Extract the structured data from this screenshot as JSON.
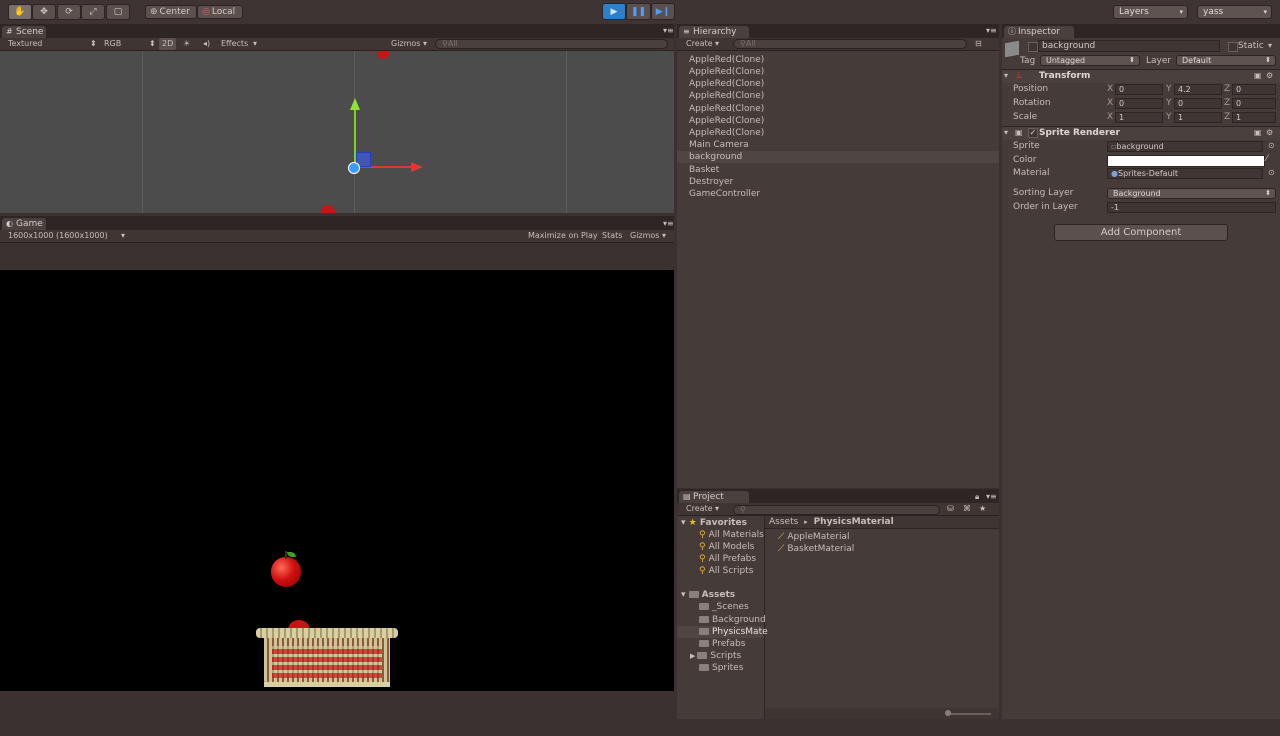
{
  "toolbar": {
    "pivot_label": "Center",
    "space_label": "Local",
    "layers_label": "Layers",
    "layout_label": "yass"
  },
  "scene": {
    "tab_label": "Scene",
    "shading": "Textured",
    "color_mode": "RGB",
    "mode_2d": "2D",
    "effects_label": "Effects",
    "gizmos_label": "Gizmos",
    "search_placeholder": "All"
  },
  "game": {
    "tab_label": "Game",
    "resolution": "1600x1000 (1600x1000)",
    "maximize_label": "Maximize on Play",
    "stats_label": "Stats",
    "gizmos_label": "Gizmos"
  },
  "hierarchy": {
    "tab_label": "Hierarchy",
    "create_label": "Create",
    "search_placeholder": "All",
    "items": [
      "AppleRed(Clone)",
      "AppleRed(Clone)",
      "AppleRed(Clone)",
      "AppleRed(Clone)",
      "AppleRed(Clone)",
      "AppleRed(Clone)",
      "AppleRed(Clone)",
      "Main Camera",
      "background",
      "Basket",
      "Destroyer",
      "GameController"
    ],
    "selected_index": 8
  },
  "project": {
    "tab_label": "Project",
    "create_label": "Create",
    "favorites_label": "Favorites",
    "favorites": [
      "All Materials",
      "All Models",
      "All Prefabs",
      "All Scripts"
    ],
    "assets_label": "Assets",
    "folders": [
      "_Scenes",
      "Background",
      "PhysicsMate",
      "Prefabs",
      "Scripts",
      "Sprites"
    ],
    "selected_folder_index": 2,
    "breadcrumb_root": "Assets",
    "breadcrumb_current": "PhysicsMaterial",
    "files": [
      "AppleMaterial",
      "BasketMaterial"
    ]
  },
  "inspector": {
    "tab_label": "Inspector",
    "object_name": "background",
    "static_label": "Static",
    "tag_label": "Tag",
    "tag_value": "Untagged",
    "layer_label": "Layer",
    "layer_value": "Default",
    "transform": {
      "title": "Transform",
      "position_label": "Position",
      "rotation_label": "Rotation",
      "scale_label": "Scale",
      "position": {
        "x": "0",
        "y": "4.2",
        "z": "0"
      },
      "rotation": {
        "x": "0",
        "y": "0",
        "z": "0"
      },
      "scale": {
        "x": "1",
        "y": "1",
        "z": "1"
      }
    },
    "sprite_renderer": {
      "title": "Sprite Renderer",
      "sprite_label": "Sprite",
      "sprite_value": "background",
      "color_label": "Color",
      "color_value": "#ffffff",
      "material_label": "Material",
      "material_value": "Sprites-Default",
      "sorting_layer_label": "Sorting Layer",
      "sorting_layer_value": "Background",
      "order_label": "Order in Layer",
      "order_value": "-1"
    },
    "add_component_label": "Add Component"
  },
  "colors": {
    "editor_bg": "#3a3130",
    "panel_bg": "#453b39",
    "selection": "#4f4543",
    "play_accent": "#2f7fc8"
  }
}
